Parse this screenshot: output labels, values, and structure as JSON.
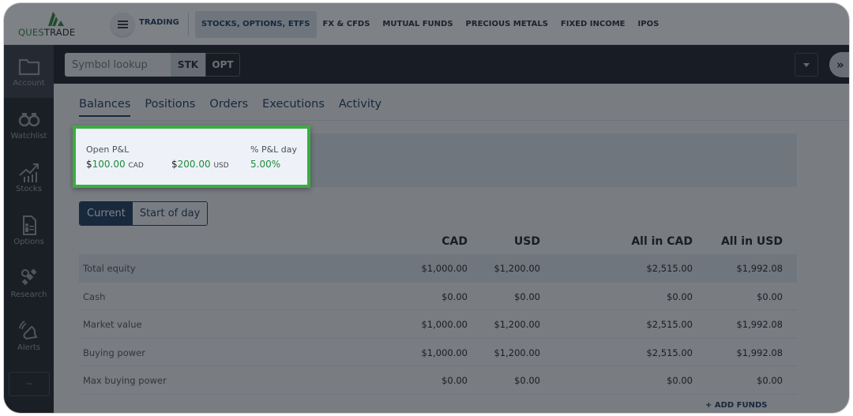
{
  "brand": {
    "name_part1": "QUES",
    "name_part2": "TRADE",
    "accent": "#2e8b3a"
  },
  "topbar": {
    "menu_icon": "hamburger-icon",
    "section": "TRADING",
    "nav": [
      {
        "label": "STOCKS, OPTIONS, ETFS",
        "active": true
      },
      {
        "label": "FX & CFDS",
        "active": false
      },
      {
        "label": "MUTUAL FUNDS",
        "active": false
      },
      {
        "label": "PRECIOUS METALS",
        "active": false
      },
      {
        "label": "FIXED INCOME",
        "active": false
      },
      {
        "label": "IPOS",
        "active": false
      }
    ]
  },
  "sidebar": {
    "items": [
      {
        "label": "Account",
        "icon": "folder-icon",
        "active": true
      },
      {
        "label": "Watchlist",
        "icon": "binoculars-icon",
        "active": false
      },
      {
        "label": "Stocks",
        "icon": "chart-up-icon",
        "active": false
      },
      {
        "label": "Options",
        "icon": "document-icon",
        "active": false
      },
      {
        "label": "Research",
        "icon": "satellite-icon",
        "active": false
      },
      {
        "label": "Alerts",
        "icon": "bell-icon",
        "active": false
      }
    ],
    "more_label": "--"
  },
  "toolbar": {
    "symbol_placeholder": "Symbol lookup",
    "stk_label": "STK",
    "opt_label": "OPT",
    "expand_label": "»"
  },
  "tabs": [
    "Balances",
    "Positions",
    "Orders",
    "Executions",
    "Activity"
  ],
  "pnl": {
    "open_label": "Open P&L",
    "cad_symbol": "$",
    "cad_value": "100.00",
    "cad_currency": "CAD",
    "usd_symbol": "$",
    "usd_value": "200.00",
    "usd_currency": "USD",
    "day_label": "% P&L day",
    "day_value": "5.00%",
    "highlight_color": "#3cac44"
  },
  "toggle": {
    "current": "Current",
    "start_of_day": "Start of day"
  },
  "table": {
    "headers": [
      "CAD",
      "USD",
      "All in CAD",
      "All in USD"
    ],
    "rows": [
      {
        "label": "Total equity",
        "values": [
          "$1,000.00",
          "$1,200.00",
          "$2,515.00",
          "$1,992.08"
        ]
      },
      {
        "label": "Cash",
        "values": [
          "$0.00",
          "$0.00",
          "$0.00",
          "$0.00"
        ]
      },
      {
        "label": "Market value",
        "values": [
          "$1,000.00",
          "$1,200.00",
          "$2,515.00",
          "$1,992.08"
        ]
      },
      {
        "label": "Buying power",
        "values": [
          "$1,000.00",
          "$1,200.00",
          "$2,515.00",
          "$1,992.08"
        ]
      },
      {
        "label": "Max buying power",
        "values": [
          "$0.00",
          "$0.00",
          "$0.00",
          "$0.00"
        ]
      }
    ]
  },
  "add_funds": "+ ADD FUNDS"
}
